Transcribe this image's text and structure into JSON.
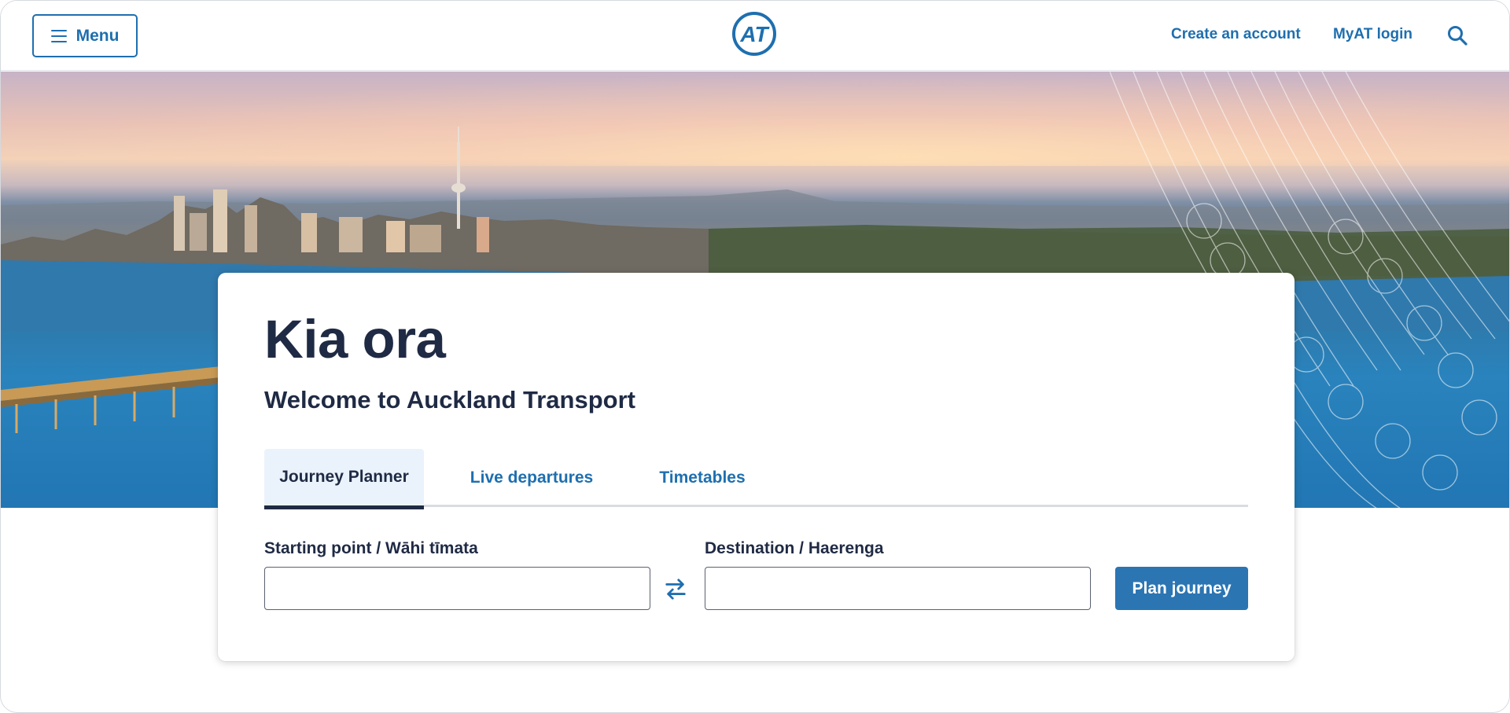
{
  "header": {
    "menu_label": "Menu",
    "logo_text": "AT",
    "create_account": "Create an account",
    "login": "MyAT login",
    "search_icon": "search-icon"
  },
  "hero": {
    "description_icon": "city-skyline-image"
  },
  "card": {
    "greeting": "Kia ora",
    "welcome": "Welcome to Auckland Transport",
    "tabs": [
      {
        "label": "Journey Planner",
        "active": true
      },
      {
        "label": "Live departures",
        "active": false
      },
      {
        "label": "Timetables",
        "active": false
      }
    ],
    "start_label": "Starting point / Wāhi tīmata",
    "start_value": "",
    "destination_label": "Destination / Haerenga",
    "destination_value": "",
    "swap_icon": "swap-arrows-icon",
    "plan_button": "Plan journey"
  },
  "colors": {
    "brand_blue": "#1e6faf",
    "button_blue": "#2b75b3",
    "text_dark": "#1f2a44",
    "active_tab_bg": "#eaf3fb"
  }
}
